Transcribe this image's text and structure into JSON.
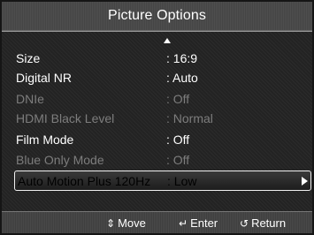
{
  "title": "Picture Options",
  "menu_items": [
    {
      "label": "Size",
      "value": ": 16:9",
      "state": "enabled"
    },
    {
      "label": "Digital NR",
      "value": ": Auto",
      "state": "enabled"
    },
    {
      "label": "DNIe",
      "value": ": Off",
      "state": "disabled"
    },
    {
      "label": "HDMI Black Level",
      "value": ": Normal",
      "state": "disabled"
    },
    {
      "label": "Film Mode",
      "value": ": Off",
      "state": "enabled"
    },
    {
      "label": "Blue Only Mode",
      "value": ": Off",
      "state": "disabled"
    },
    {
      "label": "Auto Motion Plus 120Hz",
      "value": ": Low",
      "state": "selected"
    }
  ],
  "footer": {
    "move_label": "Move",
    "move_icon": "updown-arrows-icon",
    "enter_label": "Enter",
    "enter_icon": "enter-icon",
    "return_label": "Return",
    "return_icon": "return-icon"
  },
  "colors": {
    "text": "#ffffff",
    "disabled_text": "#7d7d7d",
    "selection_border": "#f0f0f0"
  }
}
